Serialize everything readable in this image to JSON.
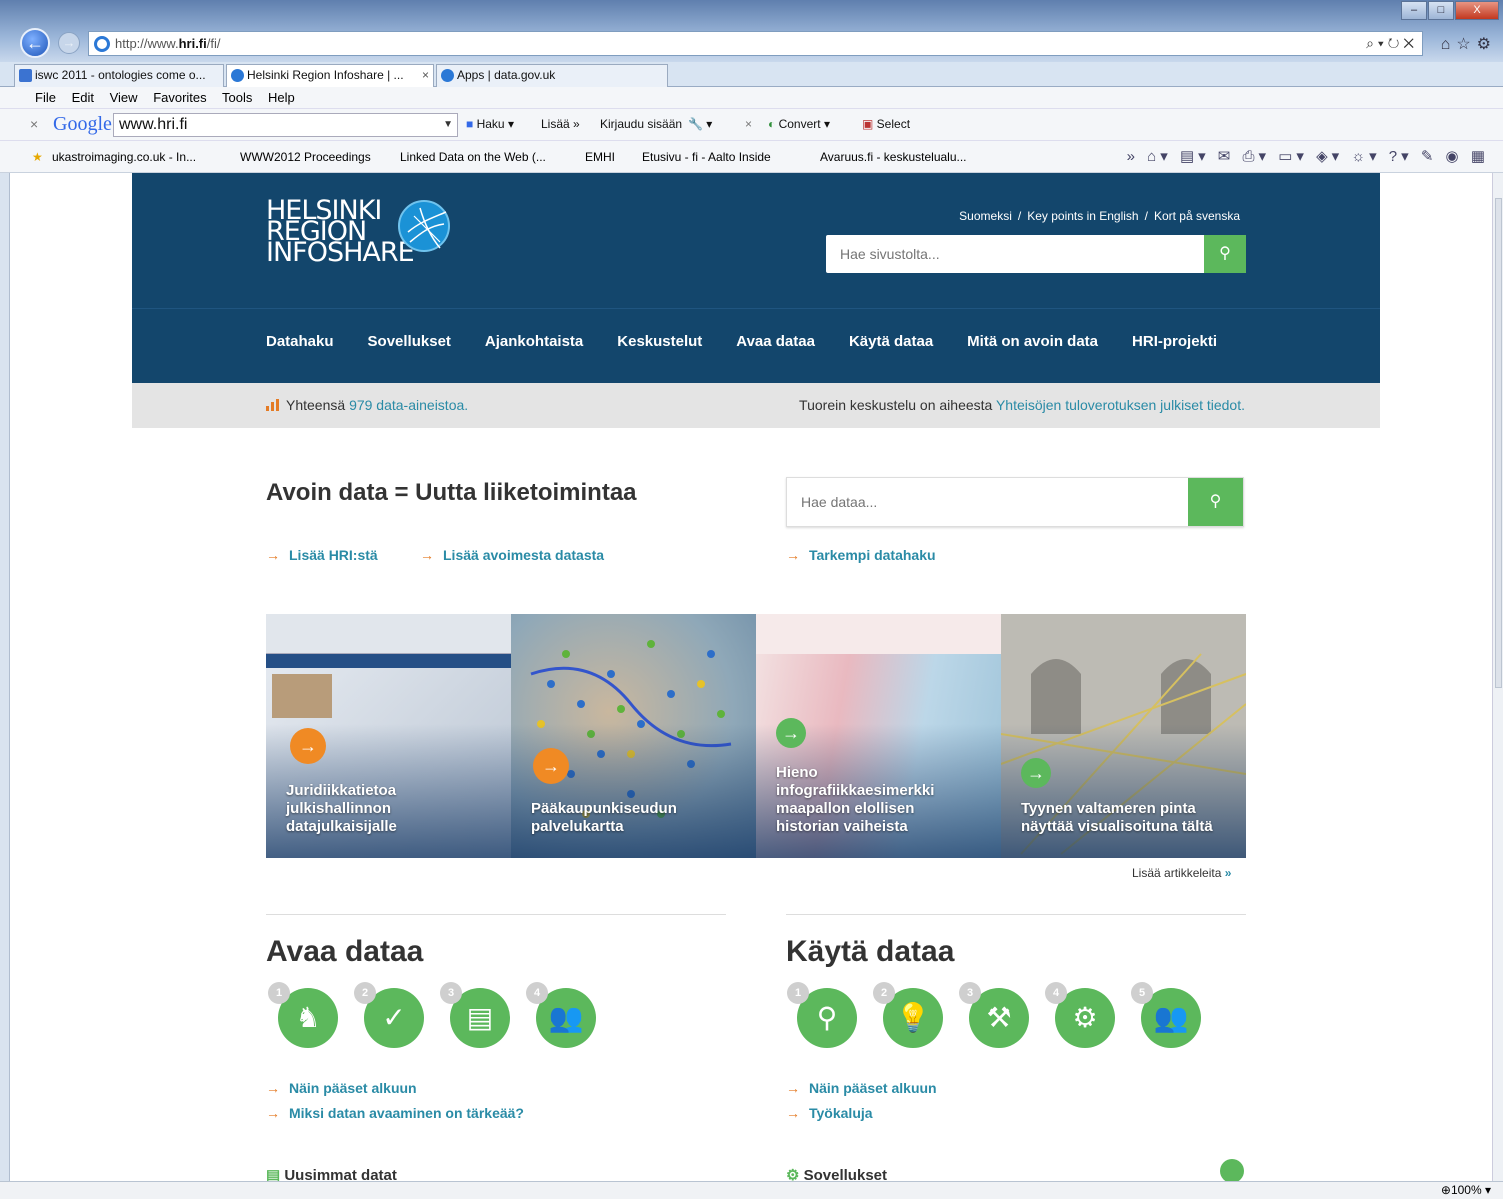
{
  "browser": {
    "url_prefix": "http://www.",
    "url_domain": "hri.fi",
    "url_suffix": "/fi/",
    "tabs": [
      {
        "label": "iswc 2011 - ontologies come o..."
      },
      {
        "label": "Helsinki Region Infoshare | ...",
        "close": "×"
      },
      {
        "label": "Apps | data.gov.uk"
      }
    ],
    "menu": [
      "File",
      "Edit",
      "View",
      "Favorites",
      "Tools",
      "Help"
    ],
    "google_bar": {
      "logo": "Google",
      "query": "www.hri.fi",
      "haku": "Haku",
      "lisaa": "Lisää »",
      "kirjaudu": "Kirjaudu sisään",
      "convert": "Convert",
      "select": "Select"
    },
    "favorites": [
      "ukastroimaging.co.uk - In...",
      "WWW2012 Proceedings",
      "Linked Data on the Web (...",
      "EMHI",
      "Etusivu - fi - Aalto Inside",
      "Avaruus.fi - keskustelualu..."
    ],
    "zoom": "100%"
  },
  "site": {
    "logo_lines": [
      "HELSINKI",
      "REGION",
      "INFOSHARE"
    ],
    "lang_links": [
      "Suomeksi",
      "Key points in English",
      "Kort på svenska"
    ],
    "lang_sep": "/",
    "search_placeholder": "Hae sivustolta...",
    "nav": [
      "Datahaku",
      "Sovellukset",
      "Ajankohtaista",
      "Keskustelut",
      "Avaa dataa",
      "Käytä dataa",
      "Mitä on avoin data",
      "HRI-projekti"
    ],
    "info": {
      "total_prefix": "Yhteensä",
      "total_link": "979 data-aineistoa.",
      "latest_prefix": "Tuorein keskustelu on aiheesta",
      "latest_link": "Yhteisöjen tuloverotuksen julkiset tiedot."
    },
    "hero_title": "Avoin data = Uutta liiketoimintaa",
    "data_search_placeholder": "Hae dataa...",
    "hero_links": [
      "Lisää HRI:stä",
      "Lisää avoimesta datasta",
      "Tarkempi datahaku"
    ],
    "tiles": [
      {
        "title": "Juridiikkatietoa julkishallinnon datajulkaisijalle"
      },
      {
        "title": "Pääkaupunkiseudun palvelukartta"
      },
      {
        "title": "Hieno infografiikkaesimerkki maapallon elollisen historian vaiheista"
      },
      {
        "title": "Tyynen valtameren pinta näyttää visualisoituna tältä"
      }
    ],
    "more_articles": "Lisää artikkeleita",
    "more_articles_arrow": "»",
    "avaa": {
      "title": "Avaa dataa",
      "steps": [
        "1",
        "2",
        "3",
        "4"
      ],
      "links": [
        "Näin pääset alkuun",
        "Miksi datan avaaminen on tärkeää?"
      ],
      "bottom": "Uusimmat datat"
    },
    "kayta": {
      "title": "Käytä dataa",
      "steps": [
        "1",
        "2",
        "3",
        "4",
        "5"
      ],
      "links": [
        "Näin pääset alkuun",
        "Työkaluja"
      ],
      "bottom": "Sovellukset"
    }
  }
}
